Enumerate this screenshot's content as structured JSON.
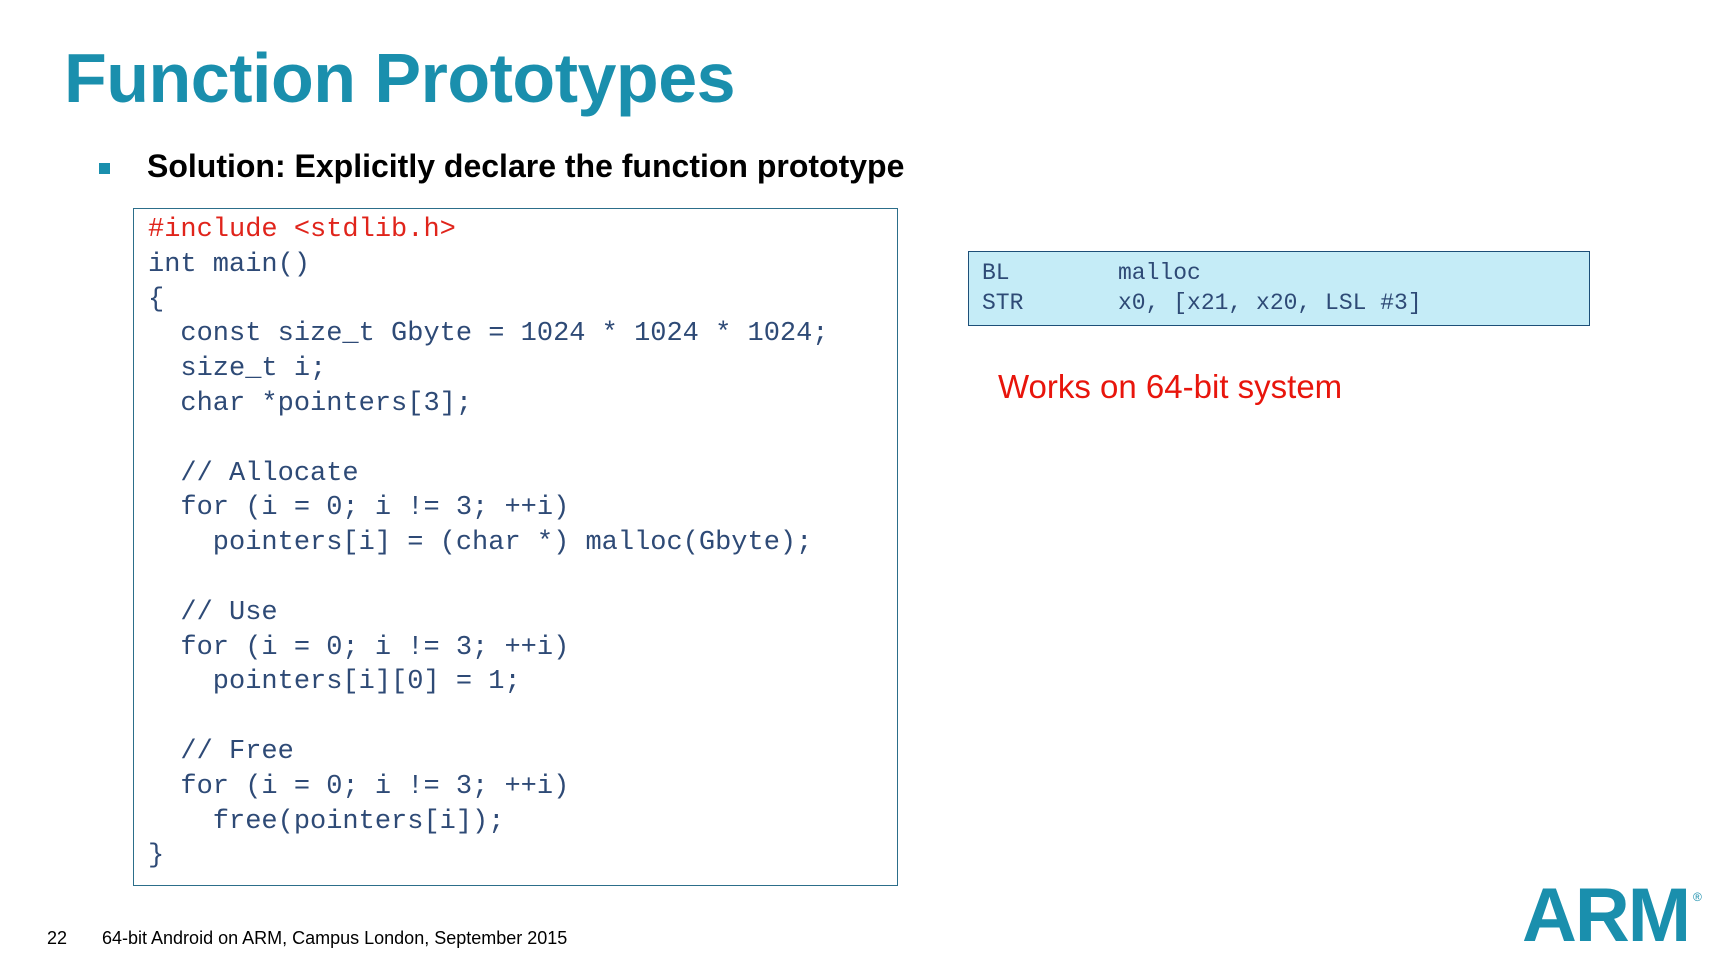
{
  "slide": {
    "title": "Function Prototypes",
    "bullet": "Solution: Explicitly declare the function prototype",
    "note": "Works on 64-bit system",
    "accent_color": "#1a8fad",
    "note_color": "#e8150c"
  },
  "code": {
    "lines": [
      "#include <stdlib.h>",
      "int main()",
      "{",
      "  const size_t Gbyte = 1024 * 1024 * 1024;",
      "  size_t i;",
      "  char *pointers[3];",
      "",
      "  // Allocate",
      "  for (i = 0; i != 3; ++i)",
      "    pointers[i] = (char *) malloc(Gbyte);",
      "",
      "  // Use",
      "  for (i = 0; i != 3; ++i)",
      "    pointers[i][0] = 1;",
      "",
      "  // Free",
      "  for (i = 0; i != 3; ++i)",
      "    free(pointers[i]);",
      "}"
    ]
  },
  "asm": {
    "rows": [
      {
        "op": "BL",
        "args": "malloc"
      },
      {
        "op": "STR",
        "args": "x0, [x21, x20, LSL #3]"
      }
    ]
  },
  "footer": {
    "page_number": "22",
    "text": "64-bit Android on ARM, Campus London, September 2015"
  },
  "logo": {
    "text": "ARM",
    "mark": "®"
  }
}
